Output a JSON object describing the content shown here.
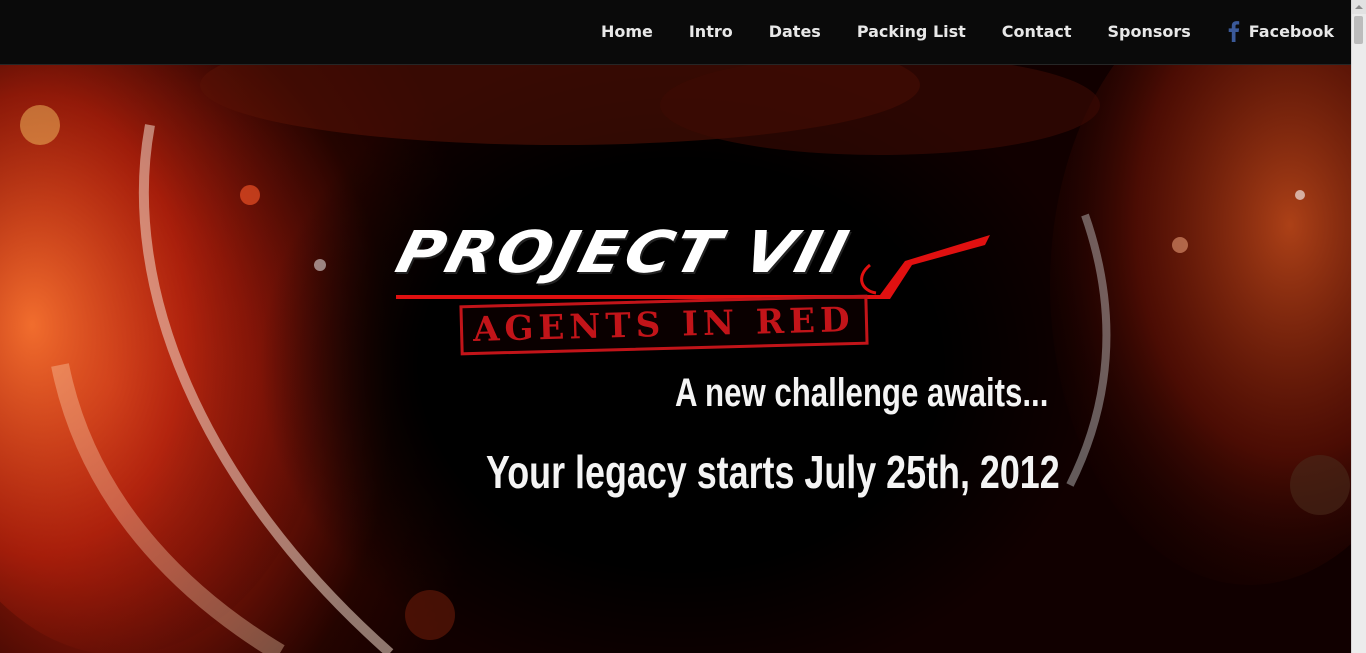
{
  "nav": {
    "items": [
      {
        "label": "Home"
      },
      {
        "label": "Intro"
      },
      {
        "label": "Dates"
      },
      {
        "label": "Packing List"
      },
      {
        "label": "Contact"
      },
      {
        "label": "Sponsors"
      }
    ],
    "facebook": {
      "label": "Facebook",
      "icon": "facebook-icon"
    }
  },
  "hero": {
    "logo_title": "PROJECT VII",
    "logo_subtitle": "AGENTS IN RED",
    "tagline_1": "A new challenge awaits...",
    "tagline_2": "Your legacy starts July 25th, 2012"
  },
  "colors": {
    "nav_bg": "#0a0a0a",
    "nav_text": "#e8e8e8",
    "accent_red": "#e01010",
    "stamp_red": "#c21419",
    "facebook_blue": "#3b5998"
  }
}
